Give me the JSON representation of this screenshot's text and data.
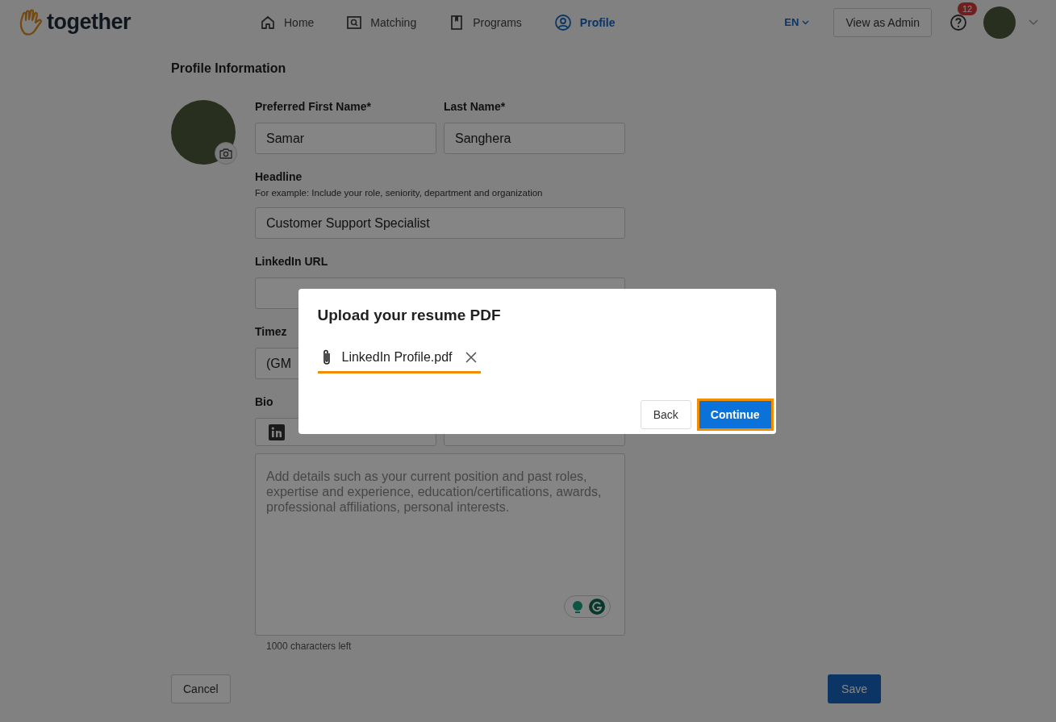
{
  "nav": {
    "logo": "together",
    "items": [
      {
        "label": "Home",
        "selected": false
      },
      {
        "label": "Matching",
        "selected": false
      },
      {
        "label": "Programs",
        "selected": false
      },
      {
        "label": "Profile",
        "selected": true
      }
    ],
    "language": "EN",
    "admin_button": "View as Admin",
    "help_badge": "12"
  },
  "page": {
    "title": "Profile Information",
    "first_name": {
      "label": "Preferred First Name*",
      "value": "Samar"
    },
    "last_name": {
      "label": "Last Name*",
      "value": "Sanghera"
    },
    "headline": {
      "label": "Headline",
      "hint": "For example: Include your role, seniority, department and organization",
      "value": "Customer Support Specialist"
    },
    "linkedin": {
      "label": "LinkedIn URL"
    },
    "timezone": {
      "label": "Timez",
      "value": "(GM"
    },
    "bio": {
      "label": "Bio",
      "placeholder": "Add details such as your current position and past roles, expertise and experience, education/certifications, awards, professional affiliations, personal interests.",
      "counter": "1000 characters left"
    },
    "cancel": "Cancel",
    "save": "Save"
  },
  "modal": {
    "title": "Upload your resume PDF",
    "file": "LinkedIn Profile.pdf",
    "back": "Back",
    "continue": "Continue"
  }
}
